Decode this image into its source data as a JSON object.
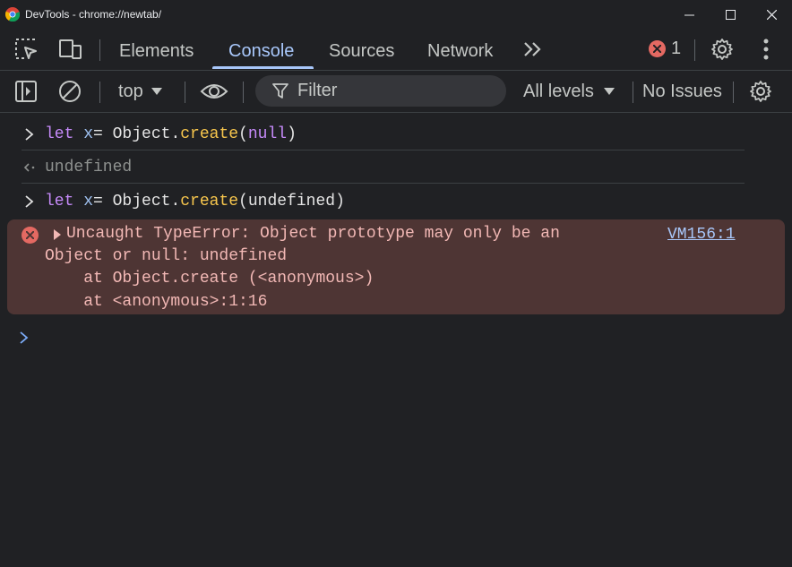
{
  "window": {
    "title": "DevTools - chrome://newtab/"
  },
  "tabs": [
    {
      "label": "Elements"
    },
    {
      "label": "Console"
    },
    {
      "label": "Sources"
    },
    {
      "label": "Network"
    }
  ],
  "tabbar": {
    "error_count": "1"
  },
  "toolbar": {
    "context": "top",
    "filter_placeholder": "Filter",
    "levels": "All levels",
    "issues": "No Issues"
  },
  "console": {
    "entries": [
      {
        "kw": "let",
        "var": "x",
        "eq": " = Object.",
        "fn": "create",
        "open": "(",
        "arg": "null",
        "close": ")"
      },
      {
        "result": "undefined"
      },
      {
        "kw": "let",
        "var": "x",
        "eq": " = Object.",
        "fn": "create",
        "args": "(undefined)"
      }
    ],
    "error": {
      "line1": "Uncaught TypeError: Object prototype may only be an",
      "line2": "Object or null: undefined",
      "line3": "    at Object.create (<anonymous>)",
      "line4": "    at <anonymous>:1:16",
      "source": "VM156:1"
    }
  },
  "colors": {
    "accent": "#a8c7fa",
    "error_bg": "#4e3534",
    "error_text": "#f2b8b5",
    "error_icon": "#e46962"
  }
}
